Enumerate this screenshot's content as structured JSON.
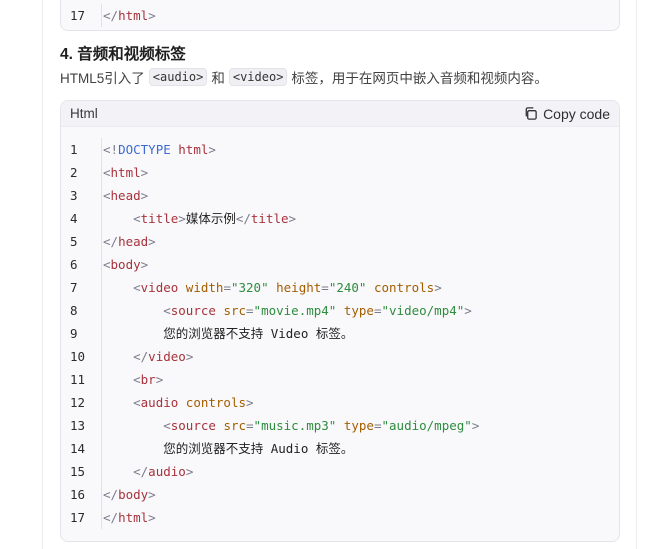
{
  "top_block": {
    "lines": [
      {
        "n": "17",
        "tokens": [
          [
            "t-punc",
            "</"
          ],
          [
            "t-tag",
            "html"
          ],
          [
            "t-punc",
            ">"
          ]
        ]
      }
    ]
  },
  "section": {
    "heading": "4. 音频和视频标签",
    "para_pre": "HTML5引入了",
    "code_audio": "<audio>",
    "para_mid": "和",
    "code_video": "<video>",
    "para_post": "标签，用于在网页中嵌入音频和视频内容。"
  },
  "code_block": {
    "language": "Html",
    "copy_label": "Copy code",
    "copy_icon": "copy-icon",
    "lines": [
      {
        "n": "1",
        "tokens": [
          [
            "t-punc",
            "<!"
          ],
          [
            "t-doc",
            "DOCTYPE "
          ],
          [
            "t-tag",
            "html"
          ],
          [
            "t-punc",
            ">"
          ]
        ]
      },
      {
        "n": "2",
        "tokens": [
          [
            "t-punc",
            "<"
          ],
          [
            "t-tag",
            "html"
          ],
          [
            "t-punc",
            ">"
          ]
        ]
      },
      {
        "n": "3",
        "tokens": [
          [
            "t-punc",
            "<"
          ],
          [
            "t-tag",
            "head"
          ],
          [
            "t-punc",
            ">"
          ]
        ]
      },
      {
        "n": "4",
        "tokens": [
          [
            "t-text",
            "    "
          ],
          [
            "t-punc",
            "<"
          ],
          [
            "t-tag",
            "title"
          ],
          [
            "t-punc",
            ">"
          ],
          [
            "t-text",
            "媒体示例"
          ],
          [
            "t-punc",
            "</"
          ],
          [
            "t-tag",
            "title"
          ],
          [
            "t-punc",
            ">"
          ]
        ]
      },
      {
        "n": "5",
        "tokens": [
          [
            "t-punc",
            "</"
          ],
          [
            "t-tag",
            "head"
          ],
          [
            "t-punc",
            ">"
          ]
        ]
      },
      {
        "n": "6",
        "tokens": [
          [
            "t-punc",
            "<"
          ],
          [
            "t-tag",
            "body"
          ],
          [
            "t-punc",
            ">"
          ]
        ]
      },
      {
        "n": "7",
        "tokens": [
          [
            "t-text",
            "    "
          ],
          [
            "t-punc",
            "<"
          ],
          [
            "t-tag",
            "video "
          ],
          [
            "t-attr",
            "width"
          ],
          [
            "t-punc",
            "="
          ],
          [
            "t-val",
            "\"320\" "
          ],
          [
            "t-attr",
            "height"
          ],
          [
            "t-punc",
            "="
          ],
          [
            "t-val",
            "\"240\" "
          ],
          [
            "t-attr",
            "controls"
          ],
          [
            "t-punc",
            ">"
          ]
        ]
      },
      {
        "n": "8",
        "tokens": [
          [
            "t-text",
            "        "
          ],
          [
            "t-punc",
            "<"
          ],
          [
            "t-tag",
            "source "
          ],
          [
            "t-attr",
            "src"
          ],
          [
            "t-punc",
            "="
          ],
          [
            "t-val",
            "\"movie.mp4\" "
          ],
          [
            "t-attr",
            "type"
          ],
          [
            "t-punc",
            "="
          ],
          [
            "t-val",
            "\"video/mp4\""
          ],
          [
            "t-punc",
            ">"
          ]
        ]
      },
      {
        "n": "9",
        "tokens": [
          [
            "t-text",
            "        您的浏览器不支持 Video 标签。"
          ]
        ]
      },
      {
        "n": "10",
        "tokens": [
          [
            "t-text",
            "    "
          ],
          [
            "t-punc",
            "</"
          ],
          [
            "t-tag",
            "video"
          ],
          [
            "t-punc",
            ">"
          ]
        ]
      },
      {
        "n": "11",
        "tokens": [
          [
            "t-text",
            "    "
          ],
          [
            "t-punc",
            "<"
          ],
          [
            "t-tag",
            "br"
          ],
          [
            "t-punc",
            ">"
          ]
        ]
      },
      {
        "n": "12",
        "tokens": [
          [
            "t-text",
            "    "
          ],
          [
            "t-punc",
            "<"
          ],
          [
            "t-tag",
            "audio "
          ],
          [
            "t-attr",
            "controls"
          ],
          [
            "t-punc",
            ">"
          ]
        ]
      },
      {
        "n": "13",
        "tokens": [
          [
            "t-text",
            "        "
          ],
          [
            "t-punc",
            "<"
          ],
          [
            "t-tag",
            "source "
          ],
          [
            "t-attr",
            "src"
          ],
          [
            "t-punc",
            "="
          ],
          [
            "t-val",
            "\"music.mp3\" "
          ],
          [
            "t-attr",
            "type"
          ],
          [
            "t-punc",
            "="
          ],
          [
            "t-val",
            "\"audio/mpeg\""
          ],
          [
            "t-punc",
            ">"
          ]
        ]
      },
      {
        "n": "14",
        "tokens": [
          [
            "t-text",
            "        您的浏览器不支持 Audio 标签。"
          ]
        ]
      },
      {
        "n": "15",
        "tokens": [
          [
            "t-text",
            "    "
          ],
          [
            "t-punc",
            "</"
          ],
          [
            "t-tag",
            "audio"
          ],
          [
            "t-punc",
            ">"
          ]
        ]
      },
      {
        "n": "16",
        "tokens": [
          [
            "t-punc",
            "</"
          ],
          [
            "t-tag",
            "body"
          ],
          [
            "t-punc",
            ">"
          ]
        ]
      },
      {
        "n": "17",
        "tokens": [
          [
            "t-punc",
            "</"
          ],
          [
            "t-tag",
            "html"
          ],
          [
            "t-punc",
            ">"
          ]
        ]
      }
    ]
  }
}
